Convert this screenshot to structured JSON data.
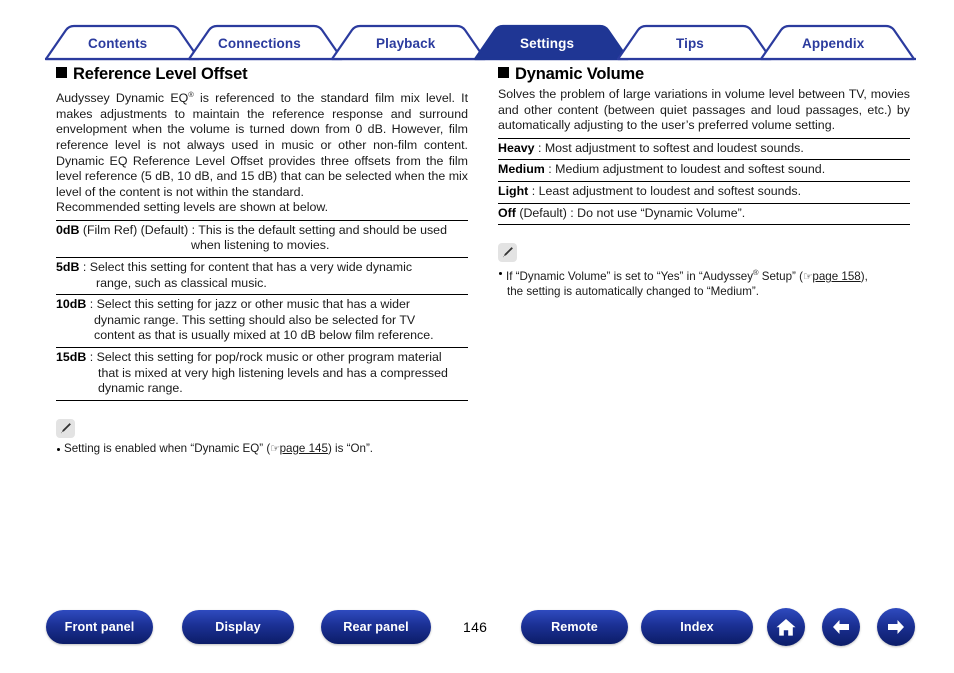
{
  "tabs": [
    {
      "label": "Contents",
      "active": false
    },
    {
      "label": "Connections",
      "active": false
    },
    {
      "label": "Playback",
      "active": false
    },
    {
      "label": "Settings",
      "active": true
    },
    {
      "label": "Tips",
      "active": false
    },
    {
      "label": "Appendix",
      "active": false
    }
  ],
  "colors": {
    "tab_border": "#2b3b9e",
    "tab_active_fill": "#1f3694",
    "tab_text": "#2b3b9e",
    "tab_active_text": "#ffffff",
    "button_blue": "#1b3094",
    "rule": "#000000"
  },
  "left": {
    "heading": "Reference Level Offset",
    "intro_main": "Audyssey Dynamic EQ",
    "intro_reg": "®",
    "intro_rest": " is referenced to the standard film mix level. It makes adjustments to maintain the reference response and surround envelopment when the volume is turned down from 0 dB. However, film reference level is not always used in music or other non-film content. Dynamic EQ Reference Level Offset provides three offsets from the film level reference (5 dB, 10 dB, and 15 dB) that can be selected when the mix level of the content is not within the standard.",
    "intro_lastline": "Recommended setting levels are shown at below.",
    "items": [
      {
        "term": "0dB",
        "line1": " (Film Ref) (Default) : This is the default setting and should be used",
        "line2": "when listening to movies."
      },
      {
        "term": "5dB",
        "line1": " : Select this setting for content that has a very wide dynamic",
        "line2": "range, such as classical music."
      },
      {
        "term": "10dB",
        "line1": " : Select this setting for jazz or other music that has a wider",
        "line2": "dynamic range. This setting should also be selected for TV",
        "line3": "content as that is usually mixed at 10 dB below film reference."
      },
      {
        "term": "15dB",
        "line1": " : Select this setting for pop/rock music or other program material",
        "line2": "that is mixed at very high listening levels and has a compressed",
        "line3": "dynamic range."
      }
    ],
    "note": {
      "icon": "pencil-icon",
      "text_before": "Setting is enabled when “Dynamic EQ” (",
      "hand_icon": "☞",
      "link": "page 145",
      "text_after": ") is “On”."
    }
  },
  "right": {
    "heading": "Dynamic Volume",
    "intro": "Solves the problem of large variations in volume level between TV, movies and other content (between quiet passages and loud passages, etc.) by automatically adjusting to the user’s preferred volume setting.",
    "items": [
      {
        "term": "Heavy",
        "rest": " : Most adjustment to softest and loudest sounds."
      },
      {
        "term": "Medium",
        "rest": " : Medium adjustment to loudest and softest sound."
      },
      {
        "term": "Light",
        "rest": " : Least adjustment to loudest and softest sounds."
      },
      {
        "term": "Off",
        "rest": " (Default) : Do not use “Dynamic Volume”."
      }
    ],
    "note": {
      "icon": "pencil-icon",
      "text_before": "If “Dynamic Volume” is set to “Yes” in “Audyssey",
      "reg": "®",
      "text_mid": " Setup” (",
      "hand_icon": "☞",
      "link": "page 158",
      "text_after": "),",
      "line2": "the setting is automatically changed to “Medium”."
    }
  },
  "bottom": {
    "buttons": [
      {
        "label": "Front panel"
      },
      {
        "label": "Display"
      },
      {
        "label": "Rear panel"
      },
      {
        "label": "Remote"
      },
      {
        "label": "Index"
      }
    ],
    "page_number": "146",
    "icons": [
      {
        "name": "home-icon"
      },
      {
        "name": "arrow-left-icon"
      },
      {
        "name": "arrow-right-icon"
      }
    ]
  }
}
